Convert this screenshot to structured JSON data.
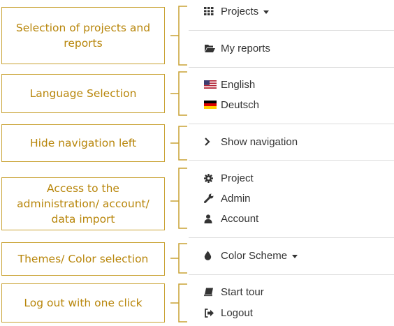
{
  "callouts": [
    {
      "text": "Selection of projects and reports"
    },
    {
      "text": "Language Selection"
    },
    {
      "text": "Hide navigation left"
    },
    {
      "text": "Access to the administration/ account/ data import"
    },
    {
      "text": "Themes/ Color selection"
    },
    {
      "text": "Log out with one click"
    }
  ],
  "menu": {
    "projects": {
      "label": "Projects",
      "icon": "grid-icon"
    },
    "my_reports": {
      "label": "My reports",
      "icon": "folder-open-icon"
    },
    "english": {
      "label": "English",
      "icon": "us-flag-icon"
    },
    "deutsch": {
      "label": "Deutsch",
      "icon": "german-flag-icon"
    },
    "show_navigation": {
      "label": "Show navigation",
      "icon": "chevron-right-icon"
    },
    "project": {
      "label": "Project",
      "icon": "gear-icon"
    },
    "admin": {
      "label": "Admin",
      "icon": "wrench-icon"
    },
    "account": {
      "label": "Account",
      "icon": "user-icon"
    },
    "color_scheme": {
      "label": "Color Scheme",
      "icon": "tint-icon"
    },
    "start_tour": {
      "label": "Start tour",
      "icon": "book-icon"
    },
    "logout": {
      "label": "Logout",
      "icon": "sign-out-icon"
    }
  },
  "colors": {
    "callout_border": "#c9a233",
    "callout_text": "#b8860b",
    "menu_text": "#333333",
    "separator": "#dcdcdc"
  }
}
